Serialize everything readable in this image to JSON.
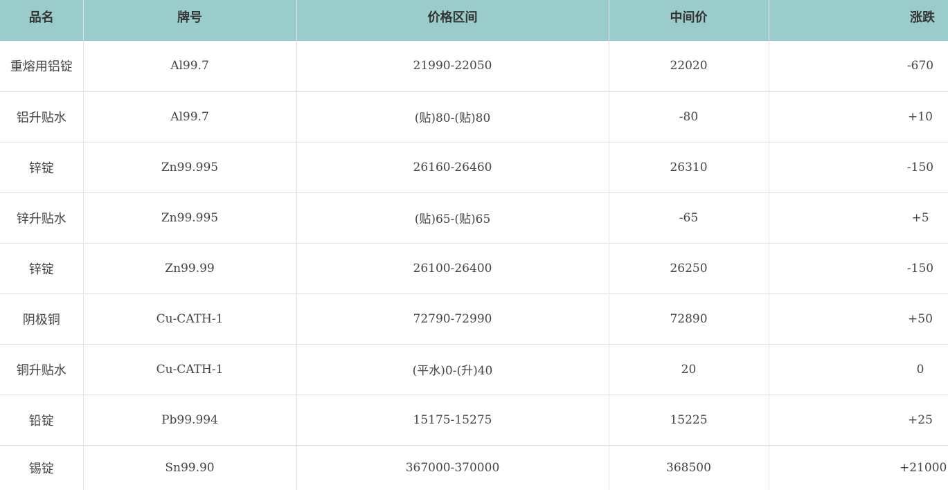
{
  "table": {
    "headers": [
      "品名",
      "牌号",
      "价格区间",
      "中间价",
      "涨跌"
    ],
    "rows": [
      {
        "name": "重熔用铝锭",
        "grade": "Al99.7",
        "range": "21990-22050",
        "mid": "22020",
        "change": "-670"
      },
      {
        "name": "铝升贴水",
        "grade": "Al99.7",
        "range": "(贴)80-(贴)80",
        "mid": "-80",
        "change": "+10"
      },
      {
        "name": "锌锭",
        "grade": "Zn99.995",
        "range": "26160-26460",
        "mid": "26310",
        "change": "-150"
      },
      {
        "name": "锌升贴水",
        "grade": "Zn99.995",
        "range": "(贴)65-(贴)65",
        "mid": "-65",
        "change": "+5"
      },
      {
        "name": "锌锭",
        "grade": "Zn99.99",
        "range": "26100-26400",
        "mid": "26250",
        "change": "-150"
      },
      {
        "name": "阴极铜",
        "grade": "Cu-CATH-1",
        "range": "72790-72990",
        "mid": "72890",
        "change": "+50"
      },
      {
        "name": "铜升贴水",
        "grade": "Cu-CATH-1",
        "range": "(平水)0-(升)40",
        "mid": "20",
        "change": "0"
      },
      {
        "name": "铅锭",
        "grade": "Pb99.994",
        "range": "15175-15275",
        "mid": "15225",
        "change": "+25"
      },
      {
        "name": "锡锭",
        "grade": "Sn99.90",
        "range": "367000-370000",
        "mid": "368500",
        "change": "+21000"
      }
    ]
  },
  "colors": {
    "header_bg": "#9acccc",
    "header_text": "#333333",
    "cell_text": "#444444",
    "grid_line": "#e2e2e2"
  }
}
